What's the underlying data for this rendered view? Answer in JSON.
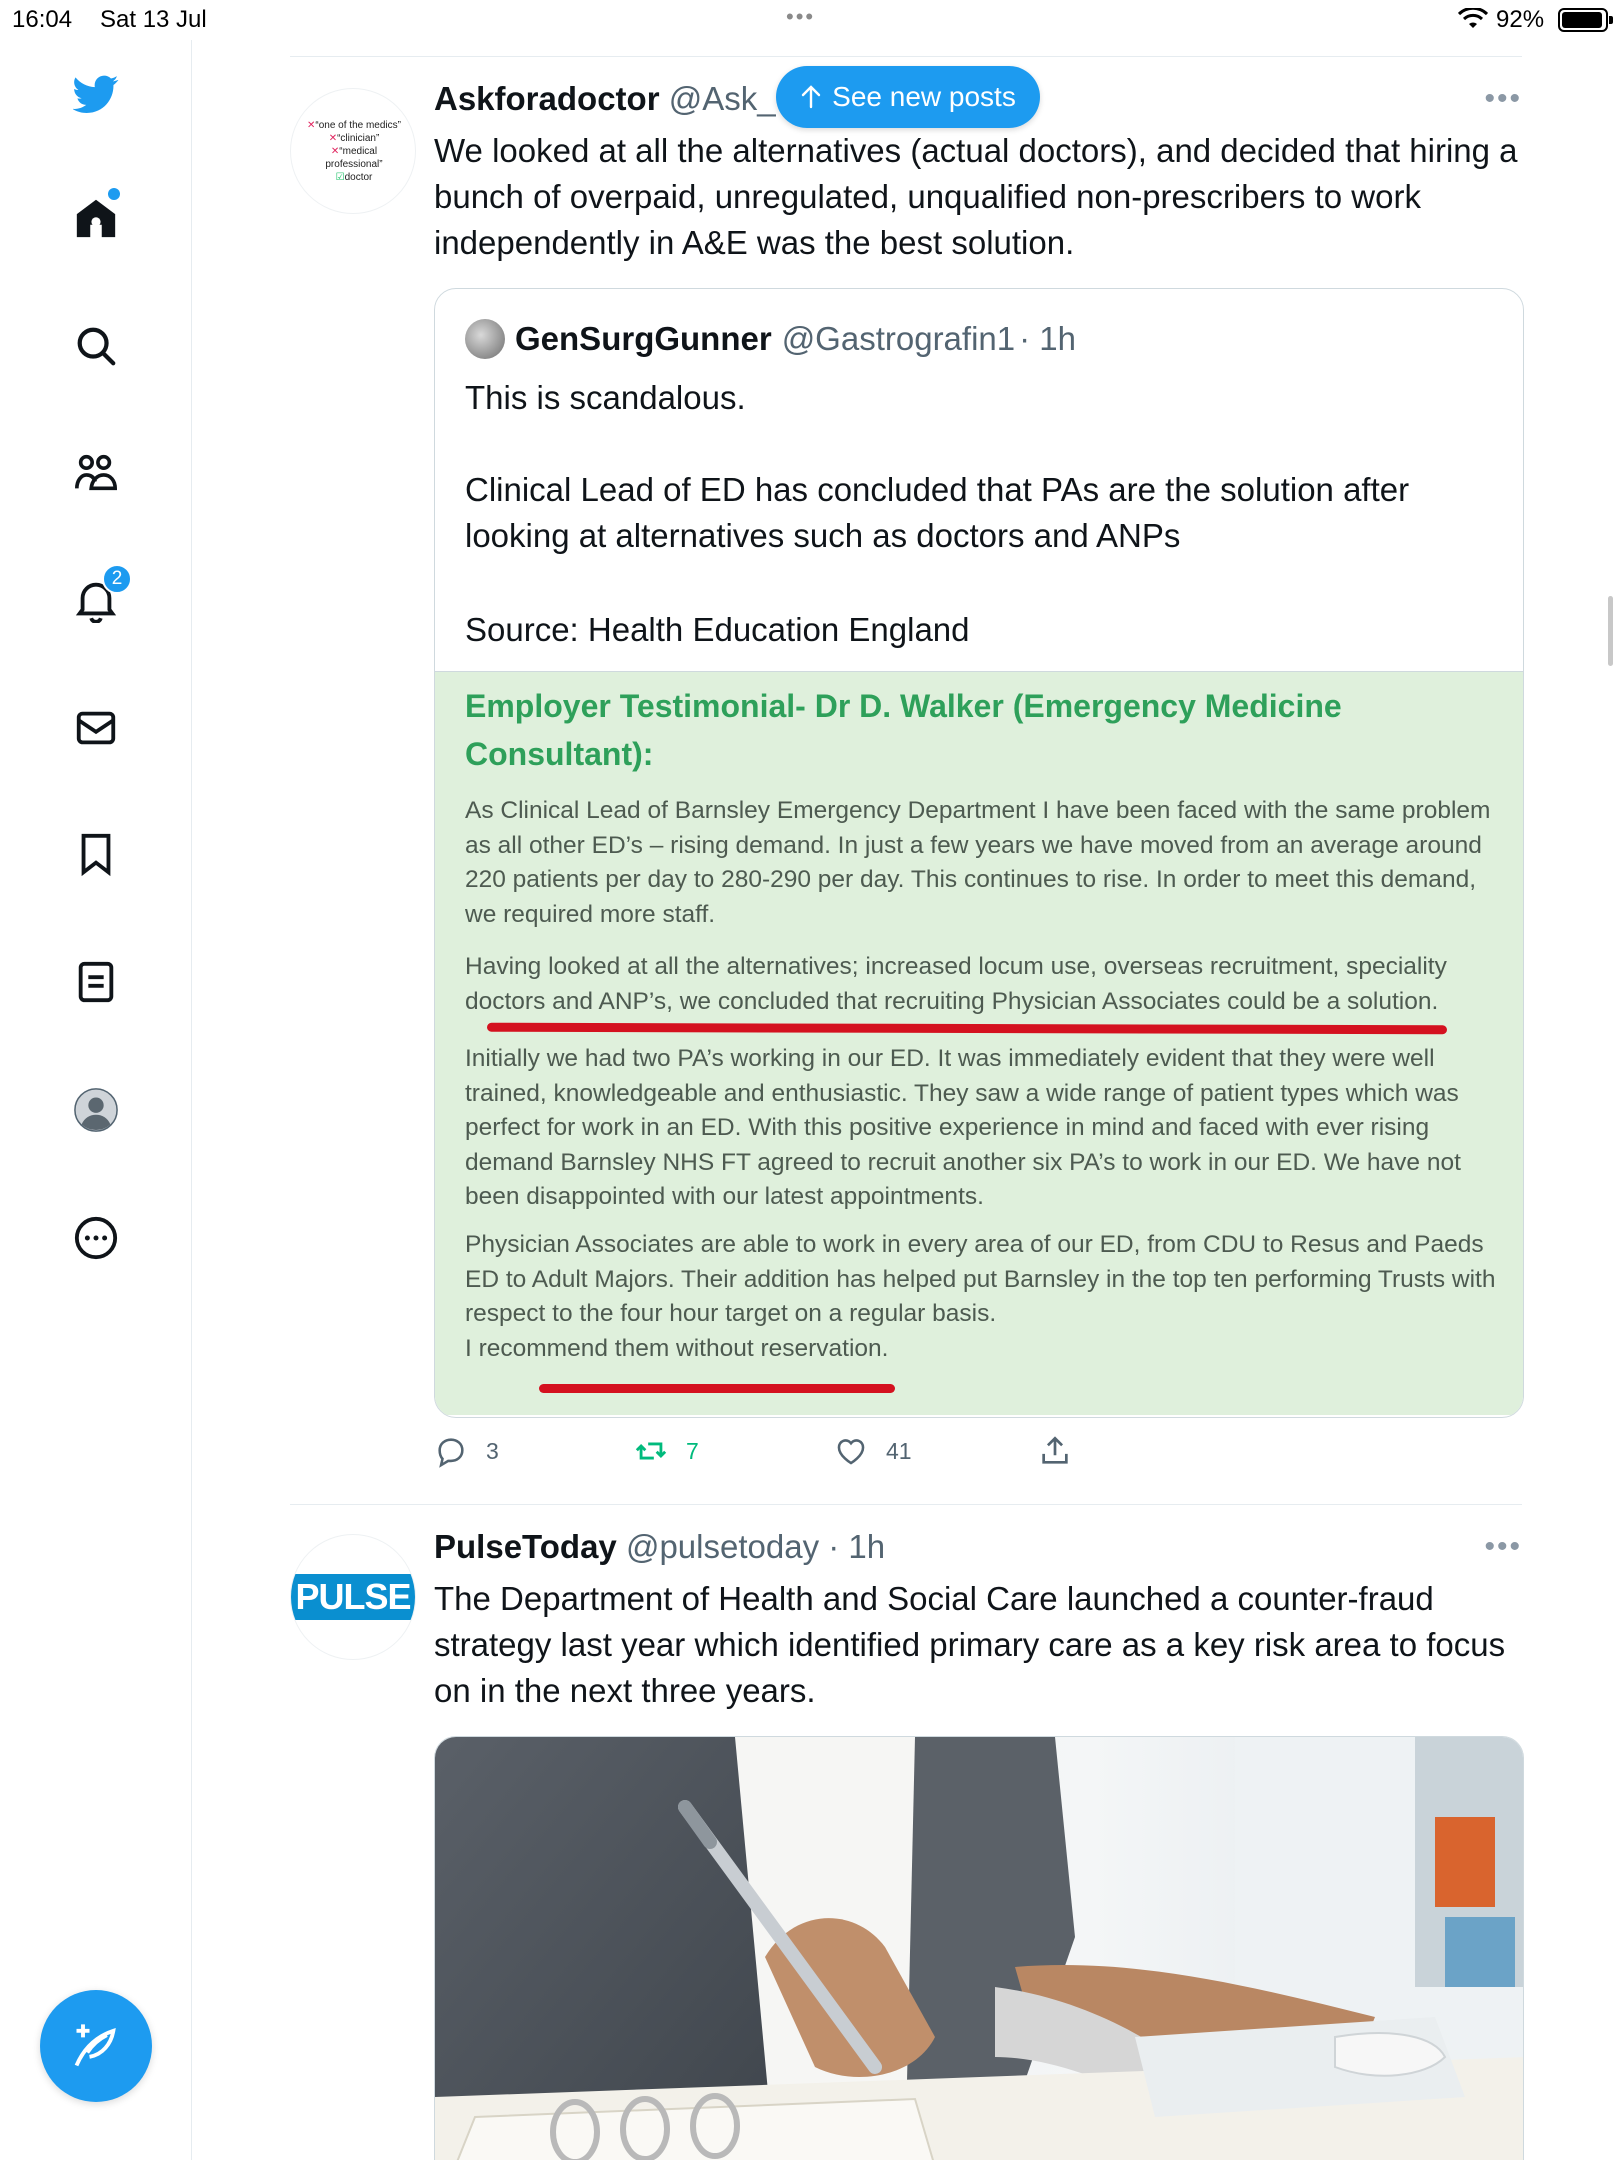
{
  "status_bar": {
    "time": "16:04",
    "date": "Sat 13 Jul",
    "battery": "92%"
  },
  "sidebar": {
    "items": [
      {
        "icon": "twitter-bird-icon"
      },
      {
        "icon": "home-icon",
        "has_dot": true
      },
      {
        "icon": "search-icon"
      },
      {
        "icon": "communities-icon"
      },
      {
        "icon": "bell-icon",
        "badge": "2"
      },
      {
        "icon": "mail-icon"
      },
      {
        "icon": "bookmark-icon"
      },
      {
        "icon": "lists-icon"
      },
      {
        "icon": "profile-avatar-icon"
      },
      {
        "icon": "more-circle-icon"
      }
    ],
    "compose_icon": "compose-feather-icon"
  },
  "see_new_posts": "See new posts",
  "tweet1": {
    "avatar_lines": [
      "“one of the medics”",
      "“clinician”",
      "“medical professional”",
      "doctor"
    ],
    "name": "Askforadoctor",
    "handle": "@Ask_",
    "text": "We looked at all the alternatives (actual doctors), and decided that hiring a bunch of overpaid, unregulated, unqualified non-prescribers to work independently in A&E was the best solution.",
    "quote": {
      "name": "GenSurgGunner",
      "handle": "@Gastrografin1",
      "time": "· 1h",
      "text1": "This is scandalous.",
      "text2": "Clinical Lead of ED has concluded that PAs are the solution after looking at alternatives such as doctors and ANPs",
      "text3": "Source: Health Education England",
      "image": {
        "title": "Employer Testimonial- Dr D. Walker (Emergency Medicine Consultant):",
        "p1": "As Clinical Lead of Barnsley Emergency Department I have been faced with the same problem as all other ED’s – rising demand. In just a few years we have moved from an average around 220 patients per day to 280-290 per day. This continues to rise. In order to meet this demand, we required more staff.",
        "p2": "Having looked at all the alternatives; increased locum use, overseas recruitment, speciality doctors and ANP’s, we concluded that recruiting Physician Associates could be a solution.",
        "p3": "Initially we had two PA’s working in our ED. It was immediately evident that they were well trained, knowledgeable and enthusiastic. They saw a wide range of patient types which was perfect for work in an ED. With this positive experience in mind and faced with ever rising demand Barnsley NHS FT agreed to recruit another six PA’s to work in our ED. We have not been disappointed with our latest appointments.",
        "p4": "Physician Associates are able to work in every area of our ED, from CDU to Resus and Paeds ED to Adult Majors. Their addition has helped put Barnsley in the top ten performing Trusts with respect to the four hour target on a regular basis.",
        "p5": "I recommend them without reservation."
      }
    },
    "actions": {
      "replies": "3",
      "retweets": "7",
      "likes": "41"
    }
  },
  "tweet2": {
    "avatar_text": "PULSE",
    "name": "PulseToday",
    "handle": "@pulsetoday",
    "time": "· 1h",
    "text": "The Department of Health and Social Care launched a counter-fraud strategy last year which identified primary care as a key risk area to focus on in the next three years."
  },
  "colors": {
    "accent": "#1d9bf0",
    "retweet_green": "#00ba7c",
    "image_bg": "#dff0dc",
    "image_title": "#2ea05a",
    "underline_red": "#d4111f"
  }
}
